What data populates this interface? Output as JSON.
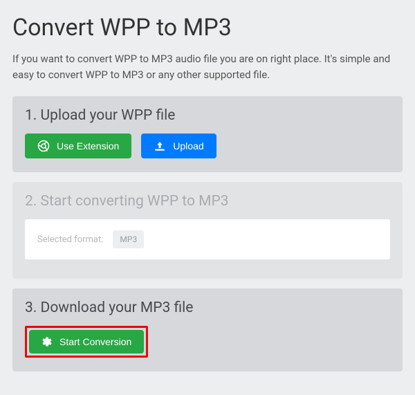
{
  "header": {
    "title": "Convert WPP to MP3",
    "description": "If you want to convert WPP to MP3 audio file you are on right place. It's simple and easy to convert WPP to MP3 or any other supported file."
  },
  "steps": {
    "step1": {
      "title": "1. Upload your WPP file",
      "extension_btn": "Use Extension",
      "upload_btn": "Upload"
    },
    "step2": {
      "title": "2. Start converting WPP to MP3",
      "format_label": "Selected format:",
      "format_value": "MP3"
    },
    "step3": {
      "title": "3. Download your MP3 file",
      "start_btn": "Start Conversion"
    }
  }
}
